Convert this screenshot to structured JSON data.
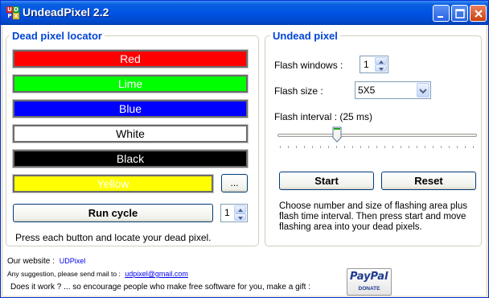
{
  "window": {
    "title": "UndeadPixel 2.2"
  },
  "app_icon": {
    "letters": [
      "U",
      "D",
      "P",
      "X"
    ]
  },
  "locator": {
    "group_title": "Dead pixel locator",
    "buttons": [
      {
        "label": "Red",
        "bg": "#ff0000",
        "fg": "#ffffff"
      },
      {
        "label": "Lime",
        "bg": "#00ff00",
        "fg": "#ffffff"
      },
      {
        "label": "Blue",
        "bg": "#0000ff",
        "fg": "#ffffff"
      },
      {
        "label": "White",
        "bg": "#ffffff",
        "fg": "#000000"
      },
      {
        "label": "Black",
        "bg": "#000000",
        "fg": "#ffffff"
      },
      {
        "label": "Yellow",
        "bg": "#ffff00",
        "fg": "#ffffff"
      }
    ],
    "custom_color_button": "...",
    "run_cycle_label": "Run cycle",
    "run_cycle_count": "1",
    "instructions": "Press each button and locate your dead pixel."
  },
  "undead": {
    "group_title": "Undead pixel",
    "flash_windows_label": "Flash windows :",
    "flash_windows_value": "1",
    "flash_size_label": "Flash size :",
    "flash_size_value": "5X5",
    "flash_interval_label": "Flash interval : (25 ms)",
    "slider_value": "25",
    "start_label": "Start",
    "reset_label": "Reset",
    "help_text_lines": [
      "Choose number and size of flashing area plus",
      "flash time interval. Then press start and move",
      "flashing area into your dead pixels."
    ]
  },
  "footer": {
    "website_label": "Our website :",
    "website_link": "UDPixel",
    "mail_label": "Any suggestion, please send mail to :",
    "mail_link": "udpixel@gmail.com",
    "donate_text": "Does it work ? ... so encourage people who make free software for you, make a gift :",
    "paypal_logo": "PayPal",
    "paypal_donate": "DONATE"
  },
  "colors": {
    "title_bar": "#0054e3",
    "group_title": "#0046d5",
    "link": "#0000ee",
    "paypal_blue": "#1f3a8f",
    "paypal_light": "#3b8fd8"
  }
}
